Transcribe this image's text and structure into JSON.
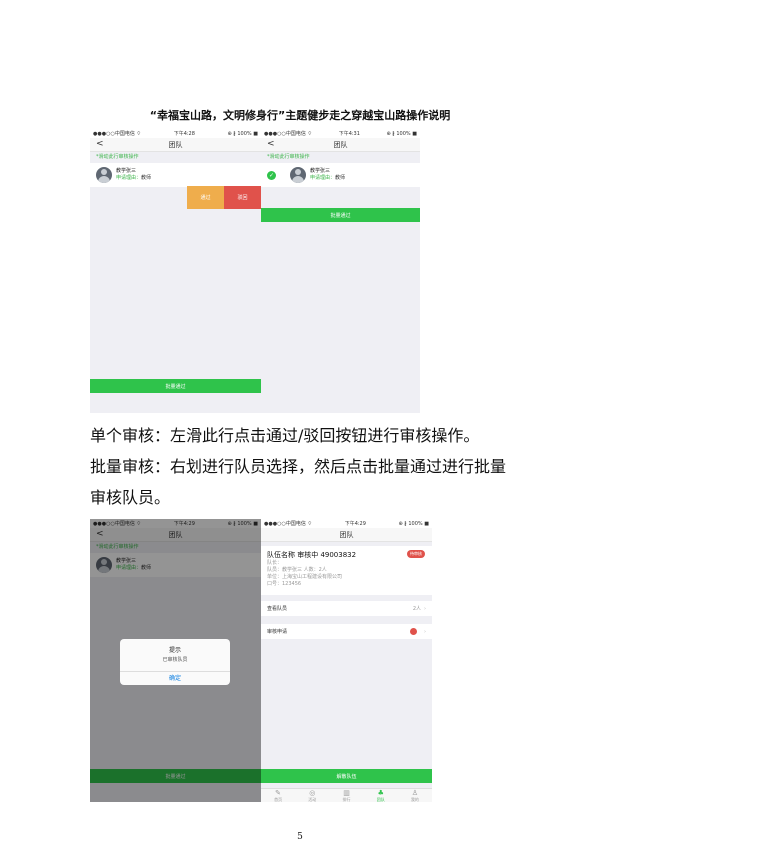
{
  "doc_title": "“幸福宝山路，文明修身行”主题健步走之穿越宝山路操作说明",
  "status": {
    "carrier": "●●●○○中国电信 ⌔",
    "time_a": "下午4:28",
    "time_b": "下午4:29",
    "time_c": "下午4:31",
    "icons": "⊕ ∦ 100% ■"
  },
  "nav": {
    "back": "<",
    "title": "团队"
  },
  "hint": "*滑动此行审核操作",
  "member": {
    "name": "教学张三",
    "reason_label": "申请理由：",
    "reason": "教师"
  },
  "swipe": {
    "pass": "通过",
    "reject": "驳回"
  },
  "batch_button": "批量通过",
  "para1": "单个审核：左滑此行点击通过/驳回按钮进行审核操作。",
  "para2": "批量审核：右划进行队员选择，然后点击批量通过进行批量",
  "para3": "审核队员。",
  "dialog": {
    "title": "提示",
    "message": "已审核队员",
    "ok": "确定"
  },
  "team": {
    "name": "队伍名称 审核中 49003832",
    "badge": "待审核",
    "line1": "队长：",
    "line2": "队员：教学张三               人数：2人",
    "line3": "单位：上海宝山工程建设有限公司",
    "line4": "口号：123456"
  },
  "rows": {
    "members": "查看队员",
    "members_count": "2人",
    "review": "审核申请"
  },
  "exit_button": "解散队伍",
  "tabs": [
    {
      "icon": "✎",
      "label": "首页"
    },
    {
      "icon": "◎",
      "label": "活动"
    },
    {
      "icon": "▥",
      "label": "排行"
    },
    {
      "icon": "♣",
      "label": "团队"
    },
    {
      "icon": "♙",
      "label": "我的"
    }
  ],
  "page_number": "5"
}
